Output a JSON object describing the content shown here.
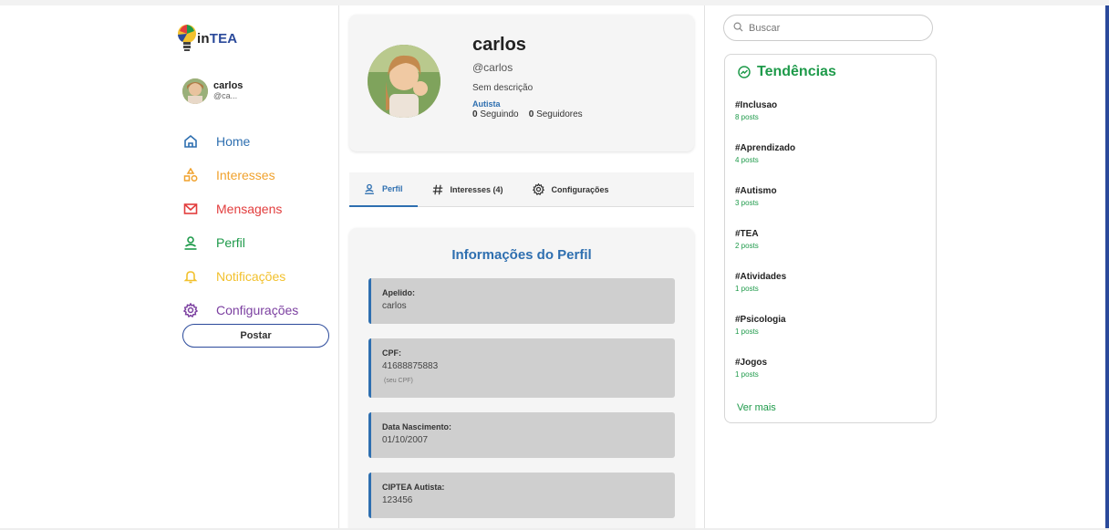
{
  "app": {
    "logo_in": "in",
    "logo_tea": "TEA"
  },
  "sidebar": {
    "user_name": "carlos",
    "user_handle": "@ca...",
    "items": [
      {
        "label": "Home",
        "color": "#2e6fb0",
        "icon": "home-icon"
      },
      {
        "label": "Interesses",
        "color": "#f0a22e",
        "icon": "shapes-icon"
      },
      {
        "label": "Mensagens",
        "color": "#e23d3d",
        "icon": "mail-icon"
      },
      {
        "label": "Perfil",
        "color": "#1e9a4a",
        "icon": "user-icon"
      },
      {
        "label": "Notificações",
        "color": "#f2c12e",
        "icon": "bell-icon"
      },
      {
        "label": "Configurações",
        "color": "#7b3fa0",
        "icon": "gear-icon"
      }
    ],
    "post_label": "Postar"
  },
  "profile": {
    "name": "carlos",
    "handle": "@carlos",
    "description": "Sem descrição",
    "tag": "Autista",
    "following_count": "0",
    "following_label": "Seguindo",
    "followers_count": "0",
    "followers_label": "Seguidores"
  },
  "tabs": [
    {
      "label": "Perfil",
      "active": true
    },
    {
      "label": "Interesses (4)",
      "active": false
    },
    {
      "label": "Configurações",
      "active": false
    }
  ],
  "info": {
    "title": "Informações do Perfil",
    "fields": [
      {
        "label": "Apelido:",
        "value": "carlos",
        "hint": ""
      },
      {
        "label": "CPF:",
        "value": "41688875883",
        "hint": "(seu CPF)"
      },
      {
        "label": "Data Nascimento:",
        "value": "01/10/2007",
        "hint": ""
      },
      {
        "label": "CIPTEA Autista:",
        "value": "123456",
        "hint": ""
      }
    ]
  },
  "search": {
    "placeholder": "Buscar"
  },
  "trends": {
    "title": "Tendências",
    "items": [
      {
        "tag": "#Inclusao",
        "posts": "8 posts"
      },
      {
        "tag": "#Aprendizado",
        "posts": "4 posts"
      },
      {
        "tag": "#Autismo",
        "posts": "3 posts"
      },
      {
        "tag": "#TEA",
        "posts": "2 posts"
      },
      {
        "tag": "#Atividades",
        "posts": "1 posts"
      },
      {
        "tag": "#Psicologia",
        "posts": "1 posts"
      },
      {
        "tag": "#Jogos",
        "posts": "1 posts"
      }
    ],
    "more_label": "Ver mais"
  },
  "colors": {
    "accent_blue": "#2e6fb0",
    "trend_green": "#1e9a4a"
  }
}
